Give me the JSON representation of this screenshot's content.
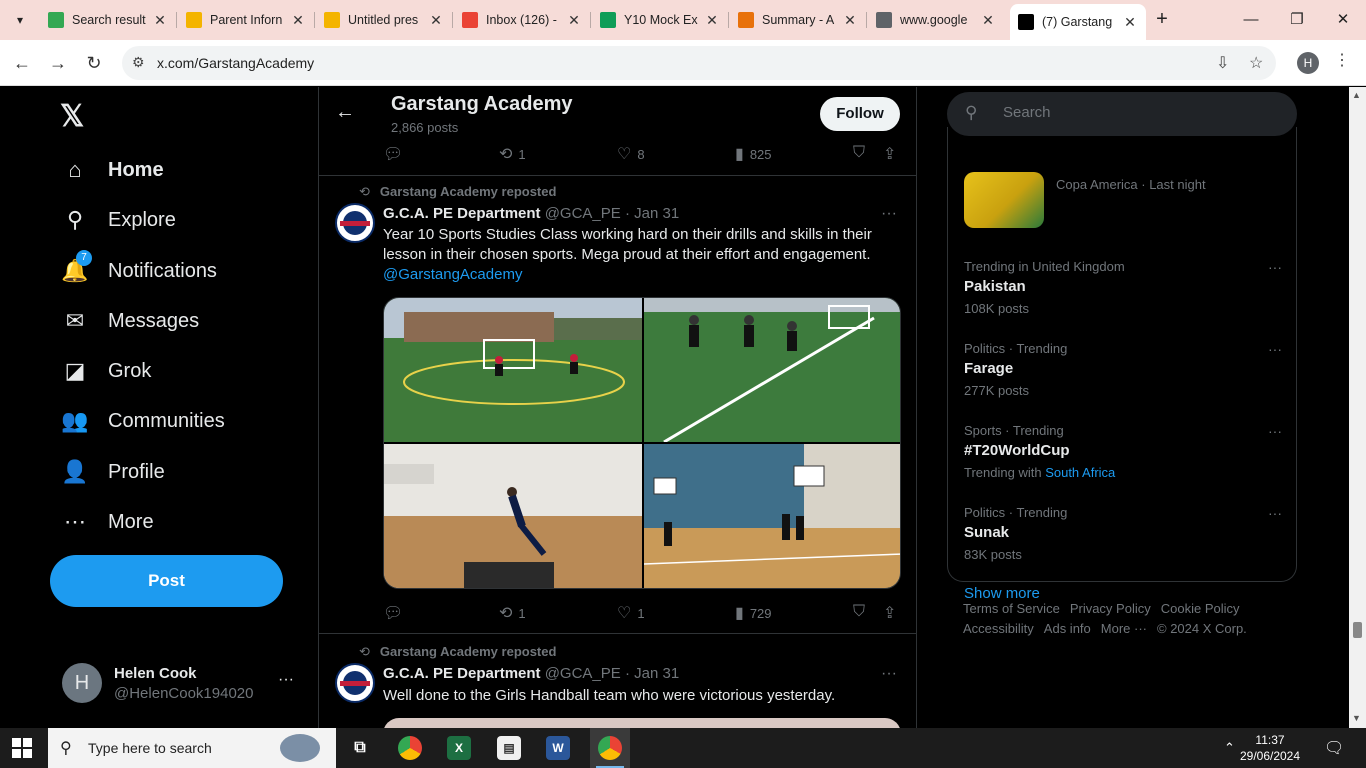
{
  "browser": {
    "tabs": [
      {
        "title": "Search result",
        "fav": "google-drive-icon",
        "color": "#34a853"
      },
      {
        "title": "Parent Inforn",
        "fav": "slides-icon",
        "color": "#f4b400"
      },
      {
        "title": "Untitled pres",
        "fav": "slides-icon",
        "color": "#f4b400"
      },
      {
        "title": "Inbox (126) -",
        "fav": "gmail-icon",
        "color": "#ea4335"
      },
      {
        "title": "Y10 Mock Ex",
        "fav": "sheets-icon",
        "color": "#0f9d58"
      },
      {
        "title": "Summary - A",
        "fav": "cloud-icon",
        "color": "#e8710a"
      },
      {
        "title": "www.google",
        "fav": "globe-icon",
        "color": "#5f6368"
      },
      {
        "title": "(7) Garstang",
        "fav": "x-icon",
        "color": "#000000"
      }
    ],
    "url": "x.com/GarstangAcademy",
    "profile_initial": "H"
  },
  "sidebar": {
    "logo": "𝕏",
    "items": [
      {
        "label": "Home",
        "icon": "⌂"
      },
      {
        "label": "Explore",
        "icon": "⚲"
      },
      {
        "label": "Notifications",
        "icon": "🔔",
        "badge": "7"
      },
      {
        "label": "Messages",
        "icon": "✉"
      },
      {
        "label": "Grok",
        "icon": "◪"
      },
      {
        "label": "Communities",
        "icon": "👥"
      },
      {
        "label": "Profile",
        "icon": "👤"
      },
      {
        "label": "More",
        "icon": "⋯"
      }
    ],
    "post_label": "Post",
    "account": {
      "initial": "H",
      "name": "Helen Cook",
      "handle": "@HelenCook194020"
    }
  },
  "timeline": {
    "header": {
      "title": "Garstang Academy",
      "count": "2,866 posts",
      "follow_label": "Follow"
    },
    "prev_actions": {
      "replies": "",
      "reposts": "1",
      "likes": "8",
      "views": "825"
    },
    "tweets": [
      {
        "repost_by": "Garstang Academy reposted",
        "name": "G.C.A. PE Department",
        "handle": "@GCA_PE",
        "date": "· Jan 31",
        "text": "Year 10 Sports Studies Class working hard on their drills and skills in their lesson in their chosen sports. Mega proud at their effort and engagement.",
        "mention": "@GarstangAcademy",
        "actions": {
          "replies": "",
          "reposts": "1",
          "likes": "1",
          "views": "729"
        }
      },
      {
        "repost_by": "Garstang Academy reposted",
        "name": "G.C.A. PE Department",
        "handle": "@GCA_PE",
        "date": "· Jan 31",
        "text": "Well done to the Girls Handball team who were victorious yesterday."
      }
    ]
  },
  "right": {
    "search_placeholder": "Search",
    "copa_meta": "Copa America · Last night",
    "trends": [
      {
        "meta": "Trending in United Kingdom",
        "name": "Pakistan",
        "posts": "108K posts"
      },
      {
        "meta": "Politics · Trending",
        "name": "Farage",
        "posts": "277K posts"
      },
      {
        "meta": "Sports · Trending",
        "name": "#T20WorldCup",
        "posts": "Trending with",
        "with_link": "South Africa"
      },
      {
        "meta": "Politics · Trending",
        "name": "Sunak",
        "posts": "83K posts"
      }
    ],
    "show_more": "Show more",
    "footer": [
      "Terms of Service",
      "Privacy Policy",
      "Cookie Policy",
      "Accessibility",
      "Ads info",
      "More ···",
      "© 2024 X Corp."
    ]
  },
  "taskbar": {
    "search_placeholder": "Type here to search",
    "time": "11:37",
    "date": "29/06/2024"
  }
}
